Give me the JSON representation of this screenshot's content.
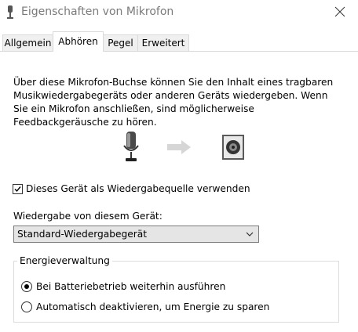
{
  "window": {
    "title": "Eigenschaften von Mikrofon",
    "icon": "microphone-icon",
    "close_icon": "close-icon"
  },
  "tabs": [
    {
      "label": "Allgemein",
      "active": false
    },
    {
      "label": "Abhören",
      "active": true
    },
    {
      "label": "Pegel",
      "active": false
    },
    {
      "label": "Erweitert",
      "active": false
    }
  ],
  "listen": {
    "description": "Über diese Mikrofon-Buchse können Sie den Inhalt eines tragbaren Musikwiedergabegeräts oder anderen Geräts wiedergeben. Wenn Sie ein Mikrofon anschließen, sind möglicherweise Feedbackgeräusche zu hören.",
    "diagram_icons": [
      "microphone-icon",
      "arrow-right-icon",
      "speaker-icon"
    ],
    "checkbox_label": "Dieses Gerät als Wiedergabequelle verwenden",
    "checkbox_checked": true,
    "playback_label": "Wiedergabe von diesem Gerät:",
    "playback_device": "Standard-Wiedergabegerät"
  },
  "power": {
    "title": "Energieverwaltung",
    "options": [
      {
        "label": "Bei Batteriebetrieb weiterhin ausführen",
        "selected": true
      },
      {
        "label": "Automatisch deaktivieren, um Energie zu sparen",
        "selected": false
      }
    ]
  }
}
